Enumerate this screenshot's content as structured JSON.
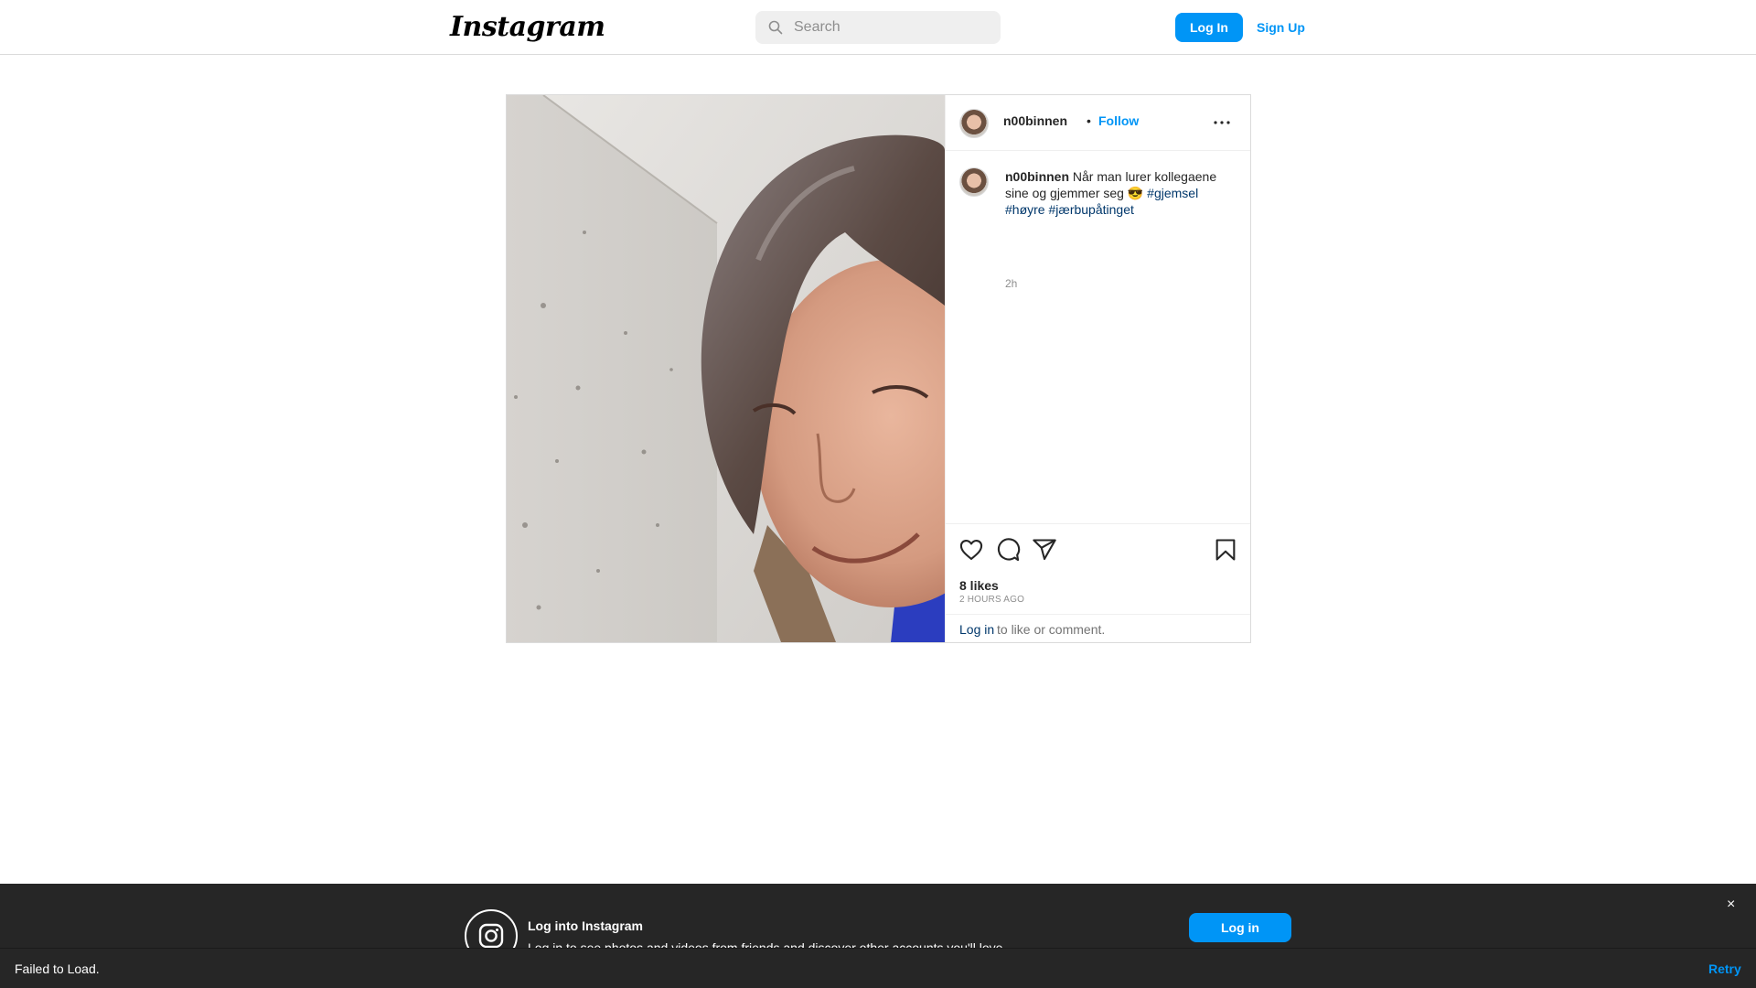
{
  "header": {
    "logo": "Instagram",
    "search_placeholder": "Search",
    "login_label": "Log In",
    "signup_label": "Sign Up"
  },
  "post": {
    "username": "n00binnen",
    "separator": "•",
    "follow_label": "Follow",
    "caption_user": "n00binnen",
    "caption_text": "Når man lurer kollegaene sine og gjemmer seg 😎",
    "hashtags": [
      "#gjemsel",
      "#høyre",
      "#jærbupåtinget"
    ],
    "caption_time": "2h",
    "likes": "8 likes",
    "time_ago": "2 HOURS AGO",
    "login_link": "Log in",
    "login_rest": "to like or comment."
  },
  "banner": {
    "title": "Log into Instagram",
    "subtitle": "Log in to see photos and videos from friends and discover other accounts you'll love.",
    "button_label": "Log in",
    "close_glyph": "×"
  },
  "toast": {
    "message": "Failed to Load.",
    "retry_label": "Retry"
  },
  "icons": {
    "search": "search-icon",
    "more": "more-options-icon",
    "like": "heart-icon",
    "comment": "comment-icon",
    "share": "share-icon",
    "save": "bookmark-icon",
    "instagram": "instagram-icon",
    "close": "close-icon"
  },
  "colors": {
    "accent": "#0095f6",
    "link": "#00376b",
    "banner_bg": "#262626"
  }
}
